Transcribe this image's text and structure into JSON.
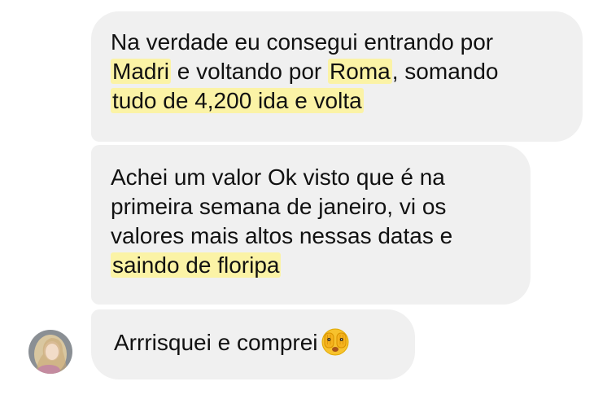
{
  "messages": [
    {
      "line1": "Na verdade eu consegui entrando por",
      "line2_hl1": "Madri",
      "line2_mid": " e voltando por ",
      "line2_hl2": "Roma",
      "line2_end": ", somando",
      "line3_hl": "tudo de 4,200 ida e volta"
    },
    {
      "line1": "Achei um valor Ok visto que é na",
      "line2": "primeira semana de janeiro, vi os",
      "line3": "valores mais altos nessas datas e",
      "line4_hl": "saindo de floripa"
    },
    {
      "text": "Arrrisquei e comprei",
      "emoji": "face-with-peeking-eye-emoji"
    }
  ],
  "avatar": "avatar-blonde-woman",
  "colors": {
    "bubble": "#f0f0f0",
    "highlight": "#fbf3a6",
    "text": "#111111"
  }
}
